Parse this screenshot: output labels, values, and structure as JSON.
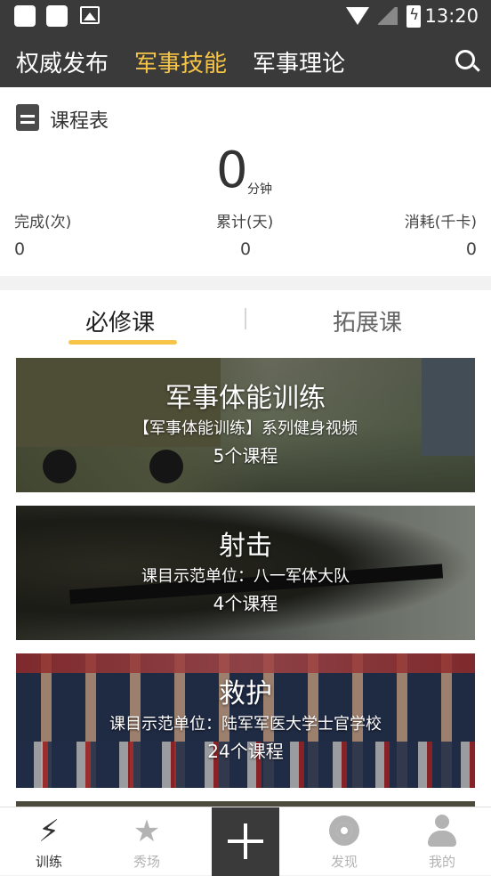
{
  "status_bar": {
    "time": "13:20"
  },
  "top_nav": {
    "tabs": [
      {
        "label": "权威发布",
        "active": false
      },
      {
        "label": "军事技能",
        "active": true
      },
      {
        "label": "军事理论",
        "active": false
      }
    ],
    "search_icon": "search-icon"
  },
  "schedule": {
    "title": "课程表",
    "total_value": "0",
    "total_unit": "分钟",
    "stats": [
      {
        "label": "完成(次)",
        "value": "0"
      },
      {
        "label": "累计(天)",
        "value": "0"
      },
      {
        "label": "消耗(千卡)",
        "value": "0"
      }
    ]
  },
  "course_tabs": [
    {
      "label": "必修课",
      "active": true
    },
    {
      "label": "拓展课",
      "active": false
    }
  ],
  "courses": [
    {
      "title": "军事体能训练",
      "subtitle": "【军事体能训练】系列健身视频",
      "count": "5个课程"
    },
    {
      "title": "射击",
      "subtitle": "课目示范单位：八一军体大队",
      "count": "4个课程"
    },
    {
      "title": "救护",
      "subtitle": "课目示范单位：陆军军医大学士官学校",
      "count": "24个课程"
    }
  ],
  "bottom_nav": [
    {
      "label": "训练",
      "icon": "lightning-icon",
      "active": true
    },
    {
      "label": "秀场",
      "icon": "star-icon",
      "active": false
    },
    {
      "label": "发现",
      "icon": "discover-icon",
      "active": false
    },
    {
      "label": "我的",
      "icon": "person-icon",
      "active": false
    }
  ],
  "colors": {
    "accent": "#f6c447",
    "bar": "#3a3a3a"
  }
}
